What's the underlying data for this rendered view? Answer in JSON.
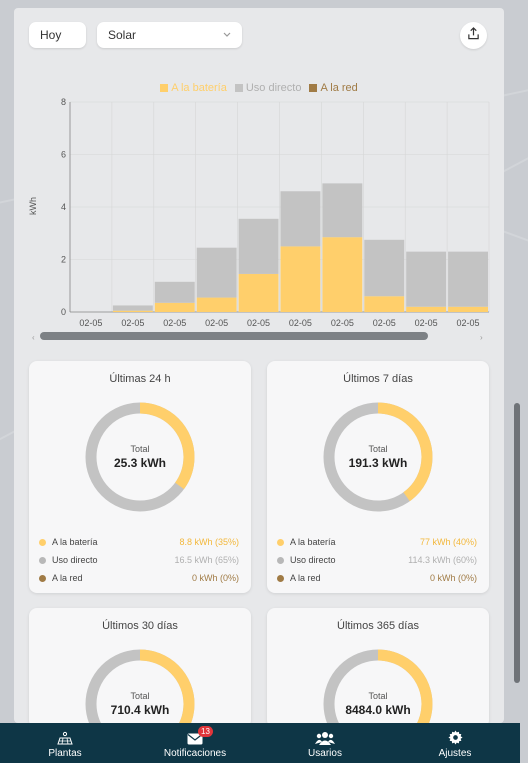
{
  "toolbar": {
    "period_label": "Hoy",
    "source_label": "Solar"
  },
  "legend": [
    {
      "label": "A la batería",
      "color": "#ffcf6b"
    },
    {
      "label": "Uso directo",
      "color": "#c3c3c3"
    },
    {
      "label": "A la red",
      "color": "#a07b45"
    }
  ],
  "chart_data": {
    "type": "bar",
    "ylabel": "kWh",
    "ylim": [
      0,
      8
    ],
    "yticks": [
      "0",
      "2",
      "4",
      "6",
      "8"
    ],
    "categories": [
      "02-05",
      "02-05",
      "02-05",
      "02-05",
      "02-05",
      "02-05",
      "02-05",
      "02-05",
      "02-05",
      "02-05"
    ],
    "stacked": true,
    "legend_position": "top",
    "grid": true,
    "series": [
      {
        "name": "A la batería",
        "color": "#ffcf6b",
        "values": [
          0,
          0.05,
          0.35,
          0.55,
          1.45,
          2.5,
          2.85,
          0.6,
          0.2,
          0.2
        ]
      },
      {
        "name": "Uso directo",
        "color": "#c3c3c3",
        "values": [
          0,
          0.2,
          0.8,
          1.9,
          2.1,
          2.1,
          2.05,
          2.15,
          2.1,
          2.1
        ]
      },
      {
        "name": "A la red",
        "color": "#a07b45",
        "values": [
          0,
          0,
          0,
          0,
          0,
          0,
          0,
          0,
          0,
          0
        ]
      }
    ]
  },
  "cards": [
    {
      "title": "Últimas 24 h",
      "total_label": "Total",
      "total_value": "25.3 kWh",
      "fraction_battery": 0.35,
      "rows": [
        {
          "label": "A la batería",
          "value": "8.8 kWh (35%)",
          "color": "#ffcf6b",
          "value_color": "#f3b83c"
        },
        {
          "label": "Uso directo",
          "value": "16.5 kWh (65%)",
          "color": "#b8b8b8",
          "value_color": "#b0b0b0"
        },
        {
          "label": "A la red",
          "value": "0 kWh (0%)",
          "color": "#a07b45",
          "value_color": "#a07b45"
        }
      ]
    },
    {
      "title": "Últimos 7 días",
      "total_label": "Total",
      "total_value": "191.3 kWh",
      "fraction_battery": 0.4,
      "rows": [
        {
          "label": "A la batería",
          "value": "77 kWh (40%)",
          "color": "#ffcf6b",
          "value_color": "#f3b83c"
        },
        {
          "label": "Uso directo",
          "value": "114.3 kWh (60%)",
          "color": "#b8b8b8",
          "value_color": "#b0b0b0"
        },
        {
          "label": "A la red",
          "value": "0 kWh (0%)",
          "color": "#a07b45",
          "value_color": "#a07b45"
        }
      ]
    },
    {
      "title": "Últimos 30 días",
      "total_label": "Total",
      "total_value": "710.4 kWh",
      "fraction_battery": 0.45,
      "rows": []
    },
    {
      "title": "Últimos 365 días",
      "total_label": "Total",
      "total_value": "8484.0 kWh",
      "fraction_battery": 0.42,
      "rows": []
    }
  ],
  "nav": [
    {
      "label": "Plantas",
      "icon": "solar-panel-icon"
    },
    {
      "label": "Notificaciones",
      "icon": "mail-icon",
      "badge": "13"
    },
    {
      "label": "Usarios",
      "icon": "users-icon"
    },
    {
      "label": "Ajustes",
      "icon": "gear-icon"
    }
  ]
}
